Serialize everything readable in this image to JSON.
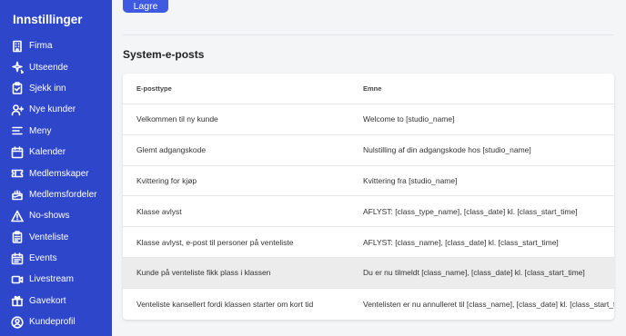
{
  "sidebar": {
    "title": "Innstillinger",
    "items": [
      {
        "label": "Firma",
        "icon": "building-icon"
      },
      {
        "label": "Utseende",
        "icon": "sparkle-icon"
      },
      {
        "label": "Sjekk inn",
        "icon": "clipboard-check-icon"
      },
      {
        "label": "Nye kunder",
        "icon": "user-plus-icon"
      },
      {
        "label": "Meny",
        "icon": "menu-icon"
      },
      {
        "label": "Kalender",
        "icon": "calendar-icon"
      },
      {
        "label": "Medlemskaper",
        "icon": "ticket-icon"
      },
      {
        "label": "Medlemsfordeler",
        "icon": "cake-icon"
      },
      {
        "label": "No-shows",
        "icon": "warning-icon"
      },
      {
        "label": "Venteliste",
        "icon": "list-clipboard-icon"
      },
      {
        "label": "Events",
        "icon": "calendar-event-icon"
      },
      {
        "label": "Livestream",
        "icon": "video-icon"
      },
      {
        "label": "Gavekort",
        "icon": "gift-icon"
      },
      {
        "label": "Kundeprofil",
        "icon": "user-circle-icon"
      }
    ]
  },
  "main": {
    "save_label": "Lagre",
    "section_title": "System-e-posts",
    "table": {
      "headers": [
        "E-posttype",
        "Emne"
      ],
      "rows": [
        [
          "Velkommen til ny kunde",
          "Welcome to [studio_name]"
        ],
        [
          "Glemt adgangskode",
          "Nulstilling af din adgangskode hos [studio_name]"
        ],
        [
          "Kvittering for kjøp",
          "Kvittering fra [studio_name]"
        ],
        [
          "Klasse avlyst",
          "AFLYST: [class_type_name], [class_date] kl. [class_start_time]"
        ],
        [
          "Klasse avlyst, e-post til personer på venteliste",
          "AFLYST: [class_name], [class_date] kl. [class_start_time]"
        ],
        [
          "Kunde på venteliste fikk plass i klassen",
          "Du er nu tilmeldt [class_name], [class_date] kl. [class_start_time]"
        ],
        [
          "Venteliste kansellert fordi klassen starter om kort tid",
          "Ventelisten er nu annulleret til [class_name], [class_date] kl. [class_start_time]"
        ]
      ],
      "highlighted_row": 5
    }
  },
  "colors": {
    "sidebar_bg": "#2e46c9",
    "button_bg": "#3d5ae0",
    "highlight_row": "#ececec"
  }
}
